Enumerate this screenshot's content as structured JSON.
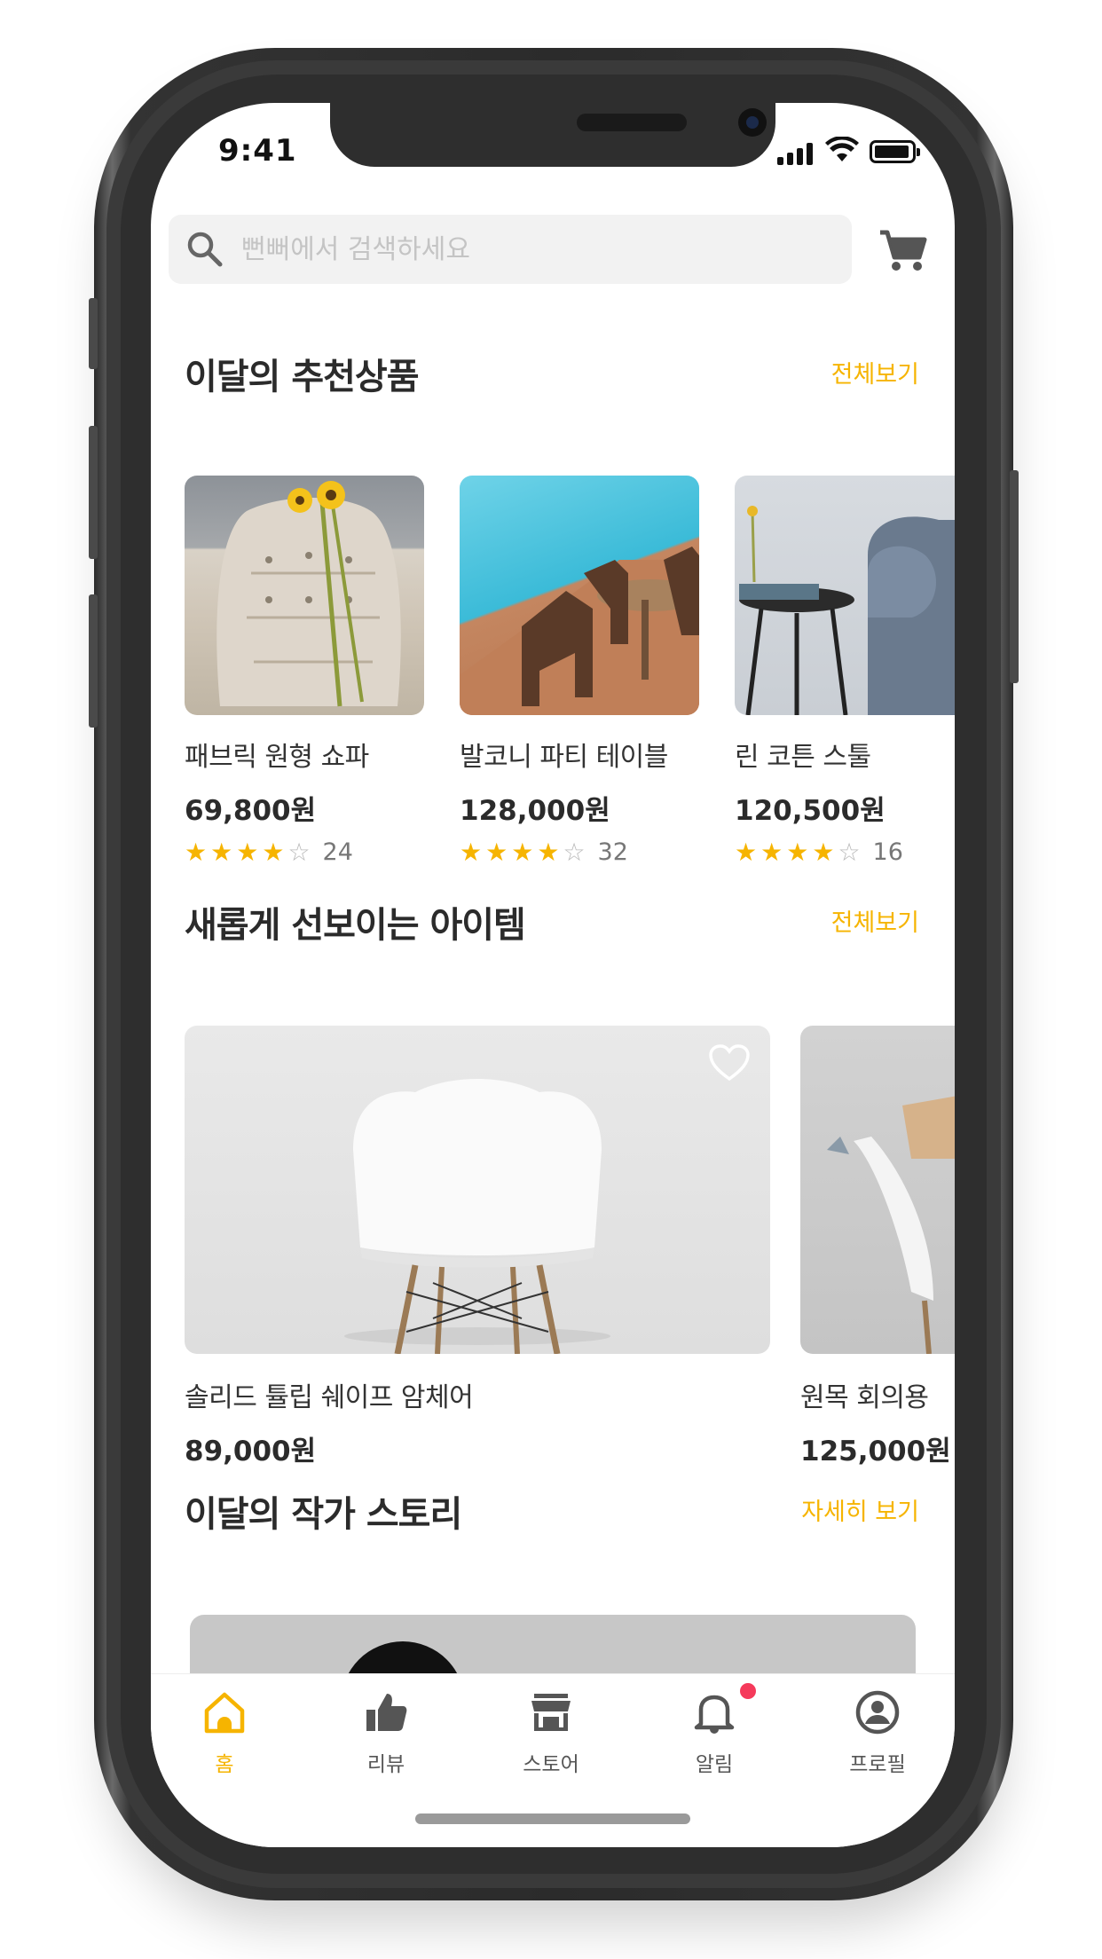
{
  "status_bar": {
    "time": "9:41"
  },
  "search": {
    "placeholder": "뻔뻐에서 검색하세요"
  },
  "recommended": {
    "title": "이달의 추천상품",
    "link": "전체보기",
    "items": [
      {
        "name": "패브릭 원형 쇼파",
        "price": "69,800원",
        "rating": 4,
        "reviews": "24"
      },
      {
        "name": "발코니 파티 테이블",
        "price": "128,000원",
        "rating": 4,
        "reviews": "32"
      },
      {
        "name": "린 코튼 스툴",
        "price": "120,500원",
        "rating": 4,
        "reviews": "16"
      }
    ]
  },
  "new_items": {
    "title": "새롭게 선보이는 아이템",
    "link": "전체보기",
    "items": [
      {
        "name": "솔리드 튤립 쉐이프 암체어",
        "price": "89,000원"
      },
      {
        "name": "원목 회의용",
        "price": "125,000원"
      }
    ]
  },
  "story": {
    "title": "이달의 작가 스토리",
    "link": "자세히 보기"
  },
  "tabbar": {
    "tabs": [
      {
        "label": "홈",
        "icon": "home-icon",
        "active": true
      },
      {
        "label": "리뷰",
        "icon": "thumbs-up-icon",
        "active": false
      },
      {
        "label": "스토어",
        "icon": "store-icon",
        "active": false
      },
      {
        "label": "알림",
        "icon": "bell-icon",
        "active": false,
        "badge": true
      },
      {
        "label": "프로필",
        "icon": "profile-icon",
        "active": false
      }
    ]
  },
  "colors": {
    "accent": "#f6b400",
    "badge": "#f53a5b",
    "star": "#f6b400"
  }
}
